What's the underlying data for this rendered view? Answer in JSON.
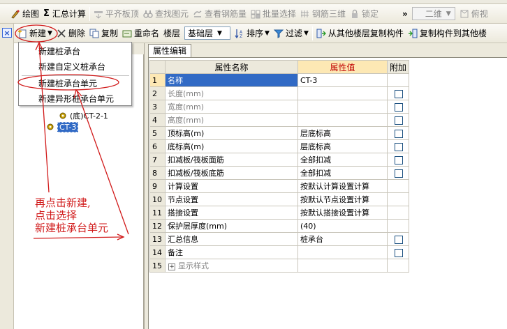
{
  "toolbar1": {
    "draw": "绘图",
    "sum_calc": "汇总计算",
    "flush_slab": "平齐板顶",
    "find_element": "查找图元",
    "view_rebar_qty": "查看钢筋量",
    "batch_select": "批量选择",
    "rebar_3d": "钢筋三维",
    "lock": "锁定",
    "more": "»",
    "view_mode": "二维",
    "top_view": "俯视"
  },
  "toolbar2": {
    "new": "新建",
    "delete": "删除",
    "copy": "复制",
    "rename": "重命名",
    "floor_label": "楼层",
    "floor_value": "基础层",
    "sort": "排序",
    "filter": "过滤",
    "copy_from_other_floor": "从其他楼层复制构件",
    "copy_to_other_floor": "复制构件到其他楼"
  },
  "new_menu": {
    "items": [
      "新建桩承台",
      "新建自定义桩承台",
      "新建桩承台单元",
      "新建异形桩承台单元"
    ]
  },
  "tree": {
    "item_bottom": "(底)CT-2-1",
    "item_selected": "CT-3"
  },
  "property_panel": {
    "tab": "属性编辑",
    "headers": {
      "name": "属性名称",
      "value": "属性值",
      "extra": "附加"
    },
    "rows": [
      {
        "no": "1",
        "name": "名称",
        "value": "CT-3",
        "check": false
      },
      {
        "no": "2",
        "name": "长度(mm)",
        "value": "",
        "check": true
      },
      {
        "no": "3",
        "name": "宽度(mm)",
        "value": "",
        "check": true
      },
      {
        "no": "4",
        "name": "高度(mm)",
        "value": "",
        "check": true
      },
      {
        "no": "5",
        "name": "顶标高(m)",
        "value": "层底标高",
        "check": true
      },
      {
        "no": "6",
        "name": "底标高(m)",
        "value": "层底标高",
        "check": true
      },
      {
        "no": "7",
        "name": "扣减板/筏板面筋",
        "value": "全部扣减",
        "check": true
      },
      {
        "no": "8",
        "name": "扣减板/筏板底筋",
        "value": "全部扣减",
        "check": true
      },
      {
        "no": "9",
        "name": "计算设置",
        "value": "按默认计算设置计算",
        "check": false
      },
      {
        "no": "10",
        "name": "节点设置",
        "value": "按默认节点设置计算",
        "check": false
      },
      {
        "no": "11",
        "name": "搭接设置",
        "value": "按默认搭接设置计算",
        "check": false
      },
      {
        "no": "12",
        "name": "保护层厚度(mm)",
        "value": "(40)",
        "check": false
      },
      {
        "no": "13",
        "name": "汇总信息",
        "value": "桩承台",
        "check": true
      },
      {
        "no": "14",
        "name": "备注",
        "value": "",
        "check": true
      },
      {
        "no": "15",
        "name": "显示样式",
        "value": "",
        "check": false
      }
    ],
    "expand_symbol": "+"
  },
  "annotation": {
    "line1": "再点击新建,",
    "line2": "点击选择",
    "line3": "新建桩承台单元"
  },
  "colors": {
    "annotation_red": "#d11a1a",
    "selection_blue": "#316ac5",
    "header_highlight": "#fde8b4"
  }
}
